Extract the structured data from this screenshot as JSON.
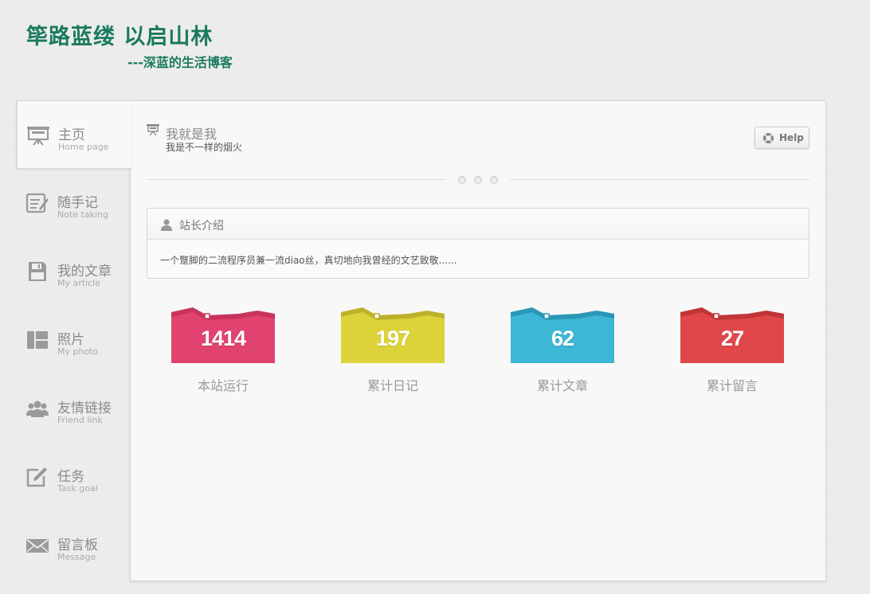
{
  "site": {
    "title": "筚路蓝缕 以启山林",
    "subtitle": "---深蓝的生活博客"
  },
  "nav": {
    "items": [
      {
        "label": "主页",
        "sub": "Home page",
        "icon": "presentation-board-icon",
        "active": true
      },
      {
        "label": "随手记",
        "sub": "Note taking",
        "icon": "notepad-icon"
      },
      {
        "label": "我的文章",
        "sub": "My article",
        "icon": "floppy-disk-icon"
      },
      {
        "label": "照片",
        "sub": "My photo",
        "icon": "gallery-icon"
      },
      {
        "label": "友情链接",
        "sub": "Friend link",
        "icon": "group-icon"
      },
      {
        "label": "任务",
        "sub": "Task goal",
        "icon": "edit-icon"
      },
      {
        "label": "留言板",
        "sub": "Message",
        "icon": "envelope-icon"
      }
    ]
  },
  "header": {
    "title": "我就是我",
    "subtitle": "我是不一样的烟火",
    "help_label": "Help"
  },
  "intro": {
    "title": "站长介绍",
    "text": "一个蹩脚的二流程序员兼一流diao丝，真切地向我曾经的文艺致敬......"
  },
  "stats": [
    {
      "value": "1414",
      "label": "本站运行",
      "color": "#e0436f",
      "dark": "#c8335c"
    },
    {
      "value": "197",
      "label": "累计日记",
      "color": "#dcd33a",
      "dark": "#bcb22a"
    },
    {
      "value": "62",
      "label": "累计文章",
      "color": "#3eb6d6",
      "dark": "#2a97b6"
    },
    {
      "value": "27",
      "label": "累计留言",
      "color": "#e0474a",
      "dark": "#c03537"
    }
  ],
  "colors": {
    "brand": "#1a7a5e",
    "icon_gray": "#9a9a9a"
  }
}
